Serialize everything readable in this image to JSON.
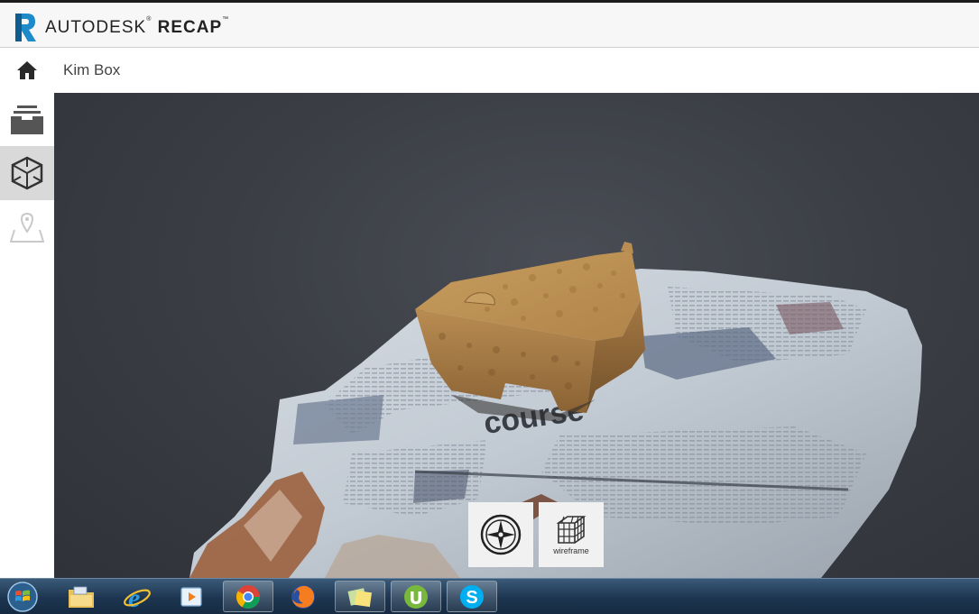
{
  "app": {
    "brand_prefix": "AUTODESK",
    "brand_name": "RECAP",
    "brand_mark": "®",
    "brand_tm": "™"
  },
  "header": {
    "title": "Kim Box"
  },
  "sidebar": {
    "items": [
      {
        "name": "inbox-icon",
        "active": false
      },
      {
        "name": "3d-model-icon",
        "active": true
      },
      {
        "name": "map-pin-icon",
        "active": false
      }
    ]
  },
  "viewer": {
    "newspaper_headline": "course",
    "tools": [
      {
        "icon": "compass-icon",
        "label": ""
      },
      {
        "icon": "wireframe-icon",
        "label": "wireframe"
      }
    ]
  },
  "taskbar": {
    "apps": [
      "windows-explorer-icon",
      "internet-explorer-icon",
      "media-player-icon",
      "chrome-icon",
      "firefox-icon",
      "sticky-notes-icon",
      "utorrent-icon",
      "skype-icon"
    ]
  },
  "colors": {
    "accent": "#1d8ac9",
    "viewport_bg": "#3b3e45",
    "sidebar_active": "#d9d9d9"
  }
}
